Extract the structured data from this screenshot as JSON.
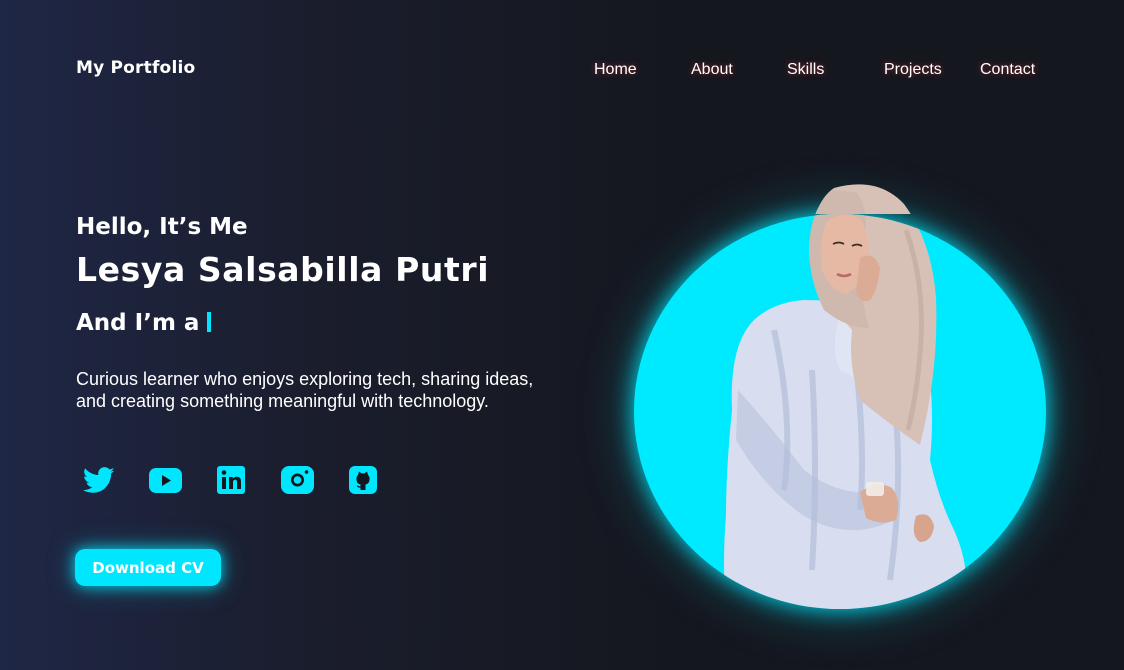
{
  "header": {
    "logo": "My Portfolio",
    "nav": [
      {
        "label": "Home"
      },
      {
        "label": "About"
      },
      {
        "label": "Skills"
      },
      {
        "label": "Projects"
      },
      {
        "label": "Contact"
      }
    ]
  },
  "hero": {
    "greeting": "Hello, It’s Me",
    "name": "Lesya Salsabilla Putri",
    "role_prefix": "And I’m a",
    "bio_line1": "Curious learner who enjoys exploring tech, sharing ideas,",
    "bio_line2": "and creating something meaningful with technology.",
    "social_icons": [
      "twitter-icon",
      "youtube-icon",
      "linkedin-icon",
      "instagram-icon",
      "github-icon"
    ],
    "cta_label": "Download CV"
  },
  "colors": {
    "accent": "#00e6ff",
    "background_dark": "#15171f",
    "background_left": "#1f2746",
    "text": "#ffffff"
  }
}
